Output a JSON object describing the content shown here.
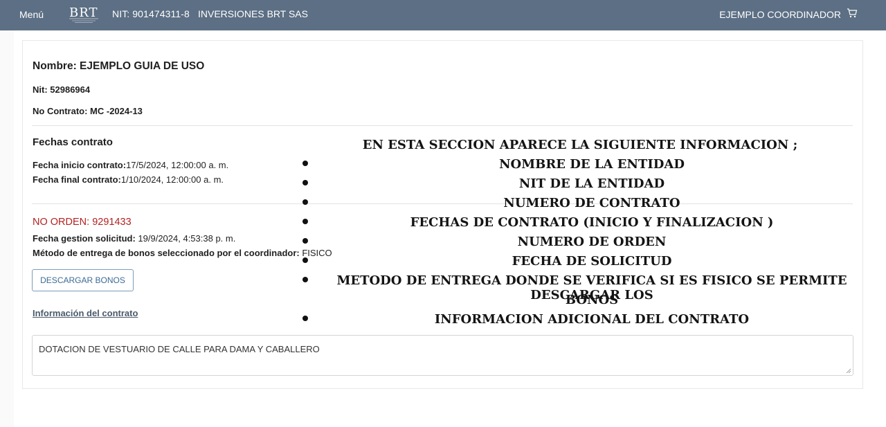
{
  "navbar": {
    "menu_label": "Menú",
    "logo_text": "BRT",
    "nit": "NIT: 901474311-8",
    "company": "INVERSIONES BRT SAS",
    "user": "EJEMPLO COORDINADOR",
    "cart_icon": "cart-icon"
  },
  "entity": {
    "name": "Nombre: EJEMPLO GUIA DE USO",
    "nit": "Nit: 52986964",
    "contract_no": "No Contrato: MC -2024-13"
  },
  "dates": {
    "section_title": "Fechas contrato",
    "start_label": "Fecha inicio contrato:",
    "start_value": "17/5/2024, 12:00:00 a. m.",
    "end_label": "Fecha final contrato:",
    "end_value": "1/10/2024, 12:00:00 a. m."
  },
  "order": {
    "number": "NO ORDEN: 9291433",
    "request_date_label": "Fecha gestion solicitud:",
    "request_date_value": " 19/9/2024, 4:53:38 p. m.",
    "delivery_method_label": "Método de entrega de bonos seleccionado por el coordinador:",
    "delivery_method_value": " FISICO",
    "download_button": "DESCARGAR BONOS"
  },
  "contract_info": {
    "link_label": "Información del contrato",
    "description": "DOTACION DE VESTUARIO DE CALLE PARA DAMA Y CABALLERO"
  },
  "annotation": {
    "title": "EN ESTA SECCION APARECE  LA SIGUIENTE INFORMACION ;",
    "items": [
      "NOMBRE DE LA ENTIDAD",
      "NIT DE LA ENTIDAD",
      "NUMERO DE CONTRATO",
      "FECHAS DE CONTRATO (INICIO Y FINALIZACION )",
      "NUMERO DE ORDEN",
      "FECHA DE SOLICITUD",
      "METODO DE ENTREGA DONDE SE VERIFICA SI ES FISICO SE PERMITE DESCARGAR LOS",
      "BONOS",
      "INFORMACION ADICIONAL DEL CONTRATO"
    ]
  }
}
